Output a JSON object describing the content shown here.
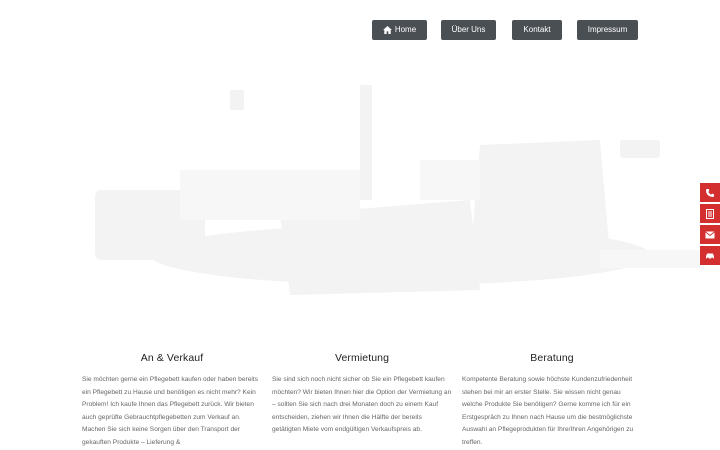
{
  "nav": {
    "items": [
      {
        "label": "Home",
        "icon": "home-icon"
      },
      {
        "label": "Über Uns"
      },
      {
        "label": "Kontakt"
      },
      {
        "label": "Impressum"
      }
    ]
  },
  "side_tabs": [
    {
      "icon": "phone-icon"
    },
    {
      "icon": "document-icon"
    },
    {
      "icon": "mail-icon"
    },
    {
      "icon": "car-icon"
    }
  ],
  "columns": [
    {
      "title": "An & Verkauf",
      "text": "Sie möchten gerne ein Pflegebett kaufen oder haben bereits ein Pflegebett zu Hause und benötigen es nicht mehr? Kein Problem! Ich kaufe Ihnen das Pflegebett zurück. Wir bieten auch geprüfte Gebrauchtpflegebetten zum Verkauf an. Machen Sie sich keine Sorgen über den Transport der gekauften Produkte – Lieferung &"
    },
    {
      "title": "Vermietung",
      "text": "Sie sind sich noch nicht sicher ob Sie ein Pflegebett kaufen möchten? Wir bieten Ihnen hier die Option der Vermietung an – sollten Sie sich nach drei Monaten doch zu einem Kauf entscheiden, ziehen wir Ihnen die Hälfte der bereits getätigten Miete vom endgültigen Verkaufspreis ab."
    },
    {
      "title": "Beratung",
      "text": "Kompetente Beratung sowie höchste Kundenzufriedenheit stehen bei mir an erster Stelle. Sie wissen nicht genau welche Produkte Sie benötigen? Gerne komme ich für ein Erstgespräch zu Ihnen nach Hause um die bestmöglichste Auswahl an Pflegeprodukten für Ihre/Ihren Angehörigen zu treffen."
    }
  ],
  "colors": {
    "nav_bg": "#4a4f54",
    "side_tab_bg": "#d32f2f",
    "body_text": "#666666"
  }
}
